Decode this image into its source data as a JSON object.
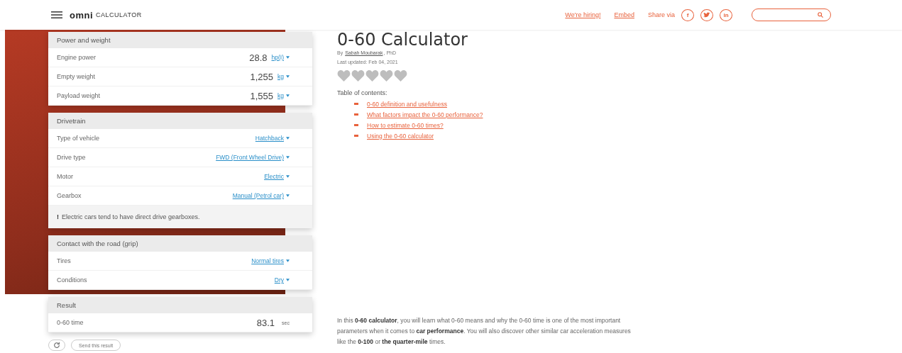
{
  "header": {
    "logo": "omni",
    "logo_suffix": "CALCULATOR",
    "links": [
      "We're hiring!",
      "Embed"
    ],
    "share_label": "Share via",
    "share_icons": [
      {
        "kind": "facebook",
        "glyph": "f"
      },
      {
        "kind": "twitter"
      },
      {
        "kind": "linkedin",
        "glyph": "in"
      }
    ]
  },
  "calculator": [
    {
      "title": "Power and weight",
      "rows": [
        {
          "kind": "number",
          "label": "Engine power",
          "value": "28.8",
          "unit": "hp(I)"
        },
        {
          "kind": "number",
          "label": "Empty weight",
          "value": "1,255",
          "unit": "kg"
        },
        {
          "kind": "number",
          "label": "Payload weight",
          "value": "1,555",
          "unit": "kg"
        }
      ]
    },
    {
      "title": "Drivetrain",
      "rows": [
        {
          "kind": "select",
          "label": "Type of vehicle",
          "unit": "Hatchback"
        },
        {
          "kind": "select",
          "label": "Drive type",
          "unit": "FWD (Front Wheel Drive)"
        },
        {
          "kind": "select",
          "label": "Motor",
          "unit": "Electric"
        },
        {
          "kind": "select",
          "label": "Gearbox",
          "unit": "Manual (Petrol car)"
        }
      ],
      "note": {
        "mark": "!",
        "text": "Electric cars tend to have direct drive gearboxes."
      }
    },
    {
      "title": "Contact with the road (grip)",
      "rows": [
        {
          "kind": "select",
          "label": "Tires",
          "unit": "Normal tires"
        },
        {
          "kind": "select",
          "label": "Conditions",
          "unit": "Dry"
        }
      ]
    },
    {
      "title": "Result",
      "rows": [
        {
          "kind": "result",
          "label": "0-60 time",
          "value": "83.1",
          "unit": "sec"
        }
      ]
    }
  ],
  "actions": {
    "send_button": "Send this result"
  },
  "article": {
    "title": "0-60 Calculator",
    "author_prefix": "By",
    "author": "Sabah Moubarak",
    "author_suffix": ", PhD",
    "updated": "Last updated: Feb 04, 2021",
    "stars": 0,
    "toc_title": "Table of contents:",
    "toc": [
      "0-60 definition and usefulness",
      "What factors impact the 0-60 performance?",
      "How to estimate 0-60 times?",
      "Using the 0-60 calculator"
    ],
    "intro": "In this **0-60 calculator**, you will learn what 0-60 means and why the 0-60 time is one of the most important parameters when it comes to **car performance**. You will also discover other similar car acceleration measures like the **0-100** or **the quarter-mile** times."
  }
}
